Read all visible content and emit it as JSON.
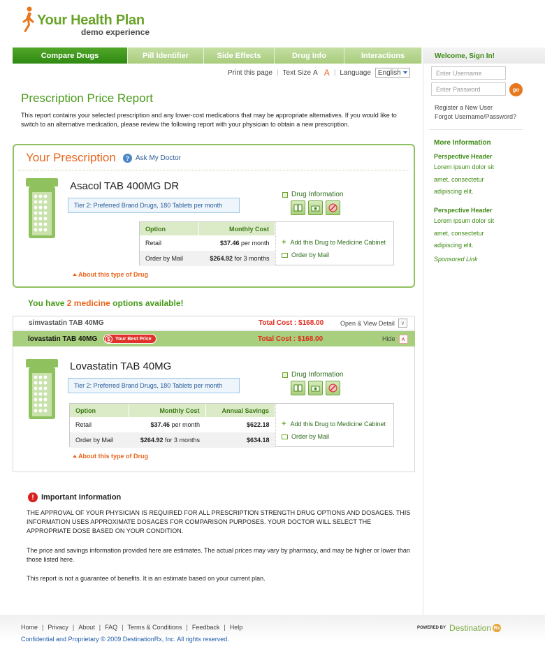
{
  "brand": {
    "title": "Your Health Plan",
    "subtitle": "demo experience",
    "accent": "#6aa32a",
    "orange": "#e8661e"
  },
  "nav": {
    "tabs": [
      {
        "label": "Compare Drugs",
        "active": true
      },
      {
        "label": "Pill Identifier"
      },
      {
        "label": "Side Effects"
      },
      {
        "label": "Drug Info"
      },
      {
        "label": "Interactions"
      }
    ]
  },
  "utility": {
    "print": "Print this page",
    "text_size": "Text Size",
    "size_small": "A",
    "size_large": "A",
    "language_label": "Language",
    "language_value": "English"
  },
  "page": {
    "title": "Prescription Price Report",
    "intro": "This report contains your selected prescription and any lower-cost medications that may be appropriate alternatives. If you would like to switch to an alternative medication, please review the following report with your physician to obtain a new prescription."
  },
  "prescription": {
    "panel_title": "Your Prescription",
    "ask_doctor": "Ask My Doctor",
    "drug_name": "Asacol TAB 400MG DR",
    "tier": "Tier 2: Preferred Brand Drugs, 180 Tablets per month",
    "drug_info": "Drug Information",
    "table": {
      "headers": [
        "Option",
        "Monthly Cost"
      ],
      "rows": [
        {
          "option": "Retail",
          "cost": "$37.46",
          "period": " per month"
        },
        {
          "option": "Order by Mail",
          "cost": "$264.92",
          "period": " for 3 months"
        }
      ]
    },
    "add_cabinet": "Add this Drug to Medicine Cabinet",
    "order_mail": "Order by Mail",
    "about": "About this type of Drug"
  },
  "options": {
    "pre": "You have ",
    "count": "2 medicine",
    "post": " options available!",
    "rows": [
      {
        "name": "simvastatin TAB 40MG",
        "total": "Total Cost : $168.00",
        "action": "Open & View Detail"
      },
      {
        "name": "lovastatin TAB 40MG",
        "badge": "Your Best Price",
        "total": "Total Cost : $168.00",
        "action": "Hide"
      }
    ]
  },
  "alternative": {
    "drug_name": "Lovastatin TAB 40MG",
    "tier": "Tier 2: Preferred Brand Drugs, 180 Tablets per month",
    "drug_info": "Drug Information",
    "table": {
      "headers": [
        "Option",
        "Monthly Cost",
        "Annual Savings"
      ],
      "rows": [
        {
          "option": "Retail",
          "cost": "$37.46",
          "period": " per month",
          "savings": "$622.18"
        },
        {
          "option": "Order by Mail",
          "cost": "$264.92",
          "period": " for 3 months",
          "savings": "$634.18"
        }
      ]
    },
    "add_cabinet": "Add this Drug to Medicine Cabinet",
    "order_mail": "Order by Mail",
    "about": "About this type of Drug"
  },
  "important": {
    "title": "Important Information",
    "p1": "THE APPROVAL OF YOUR PHYSICIAN IS REQUIRED FOR ALL PRESCRIPTION STRENGTH DRUG OPTIONS AND DOSAGES. THIS INFORMATION USES APPROXIMATE DOSAGES FOR COMPARISON PURPOSES. YOUR DOCTOR WILL SELECT THE APPROPRIATE DOSE BASED ON YOUR CONDITION.",
    "p2": "The price and savings information provided here are estimates. The actual prices may vary by pharmacy, and may be higher or lower than those listed here.",
    "p3": "This report is not a guarantee of benefits. It is an estimate based on your current plan."
  },
  "sidebar": {
    "welcome": "Welcome, Sign In!",
    "username_placeholder": "Enter Username",
    "password_placeholder": "Enter Password",
    "go": "go",
    "register": "Register a New User",
    "forgot": "Forgot Username/Password?",
    "more_info": "More Information",
    "blocks": [
      {
        "header": "Perspective Header",
        "text": "Lorem ipsum dolor sit amet, consectetur adipiscing elit."
      },
      {
        "header": "Perspective Header",
        "text": "Lorem ipsum dolor sit amet, consectetur adipiscing elit."
      }
    ],
    "sponsored": "Sponsored Link"
  },
  "footer": {
    "links": [
      "Home",
      "Privacy",
      "About",
      "FAQ",
      "Terms & Conditions",
      "Feedback",
      "Help"
    ],
    "copyright": "Confidential and Proprietary © 2009 DestinationRx, Inc. All rights reserved.",
    "powered_by": "POWERED BY",
    "partner": "Destination",
    "partner_mark": "Rx"
  }
}
